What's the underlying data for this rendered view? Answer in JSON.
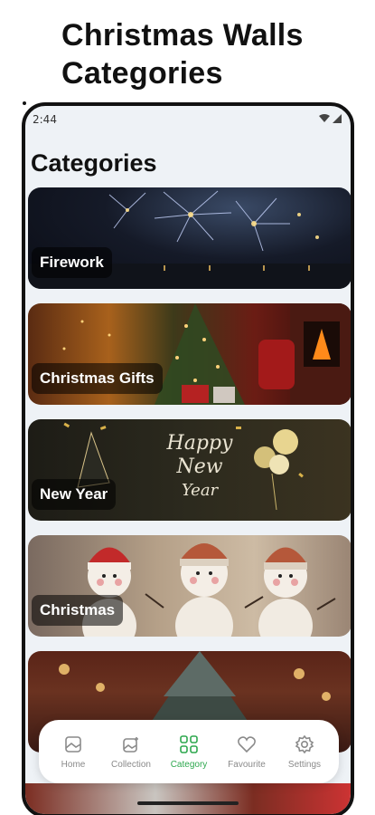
{
  "promo": {
    "title_line1": "Christmas Walls",
    "title_line2": "Categories"
  },
  "status": {
    "time": "2:44"
  },
  "screen": {
    "title": "Categories"
  },
  "categories": [
    {
      "label": "Firework"
    },
    {
      "label": "Christmas Gifts"
    },
    {
      "label": "New Year"
    },
    {
      "label": "Christmas"
    },
    {
      "label": ""
    }
  ],
  "new_year_art": {
    "line1": "Happy",
    "line2": "New",
    "line3": "Year"
  },
  "nav": {
    "items": [
      {
        "label": "Home",
        "icon": "home-image-icon"
      },
      {
        "label": "Collection",
        "icon": "collection-icon"
      },
      {
        "label": "Category",
        "icon": "category-grid-icon",
        "active": true
      },
      {
        "label": "Favourite",
        "icon": "heart-icon"
      },
      {
        "label": "Settings",
        "icon": "gear-icon"
      }
    ],
    "active_color": "#2fa84f",
    "inactive_color": "#8a8a8a"
  }
}
